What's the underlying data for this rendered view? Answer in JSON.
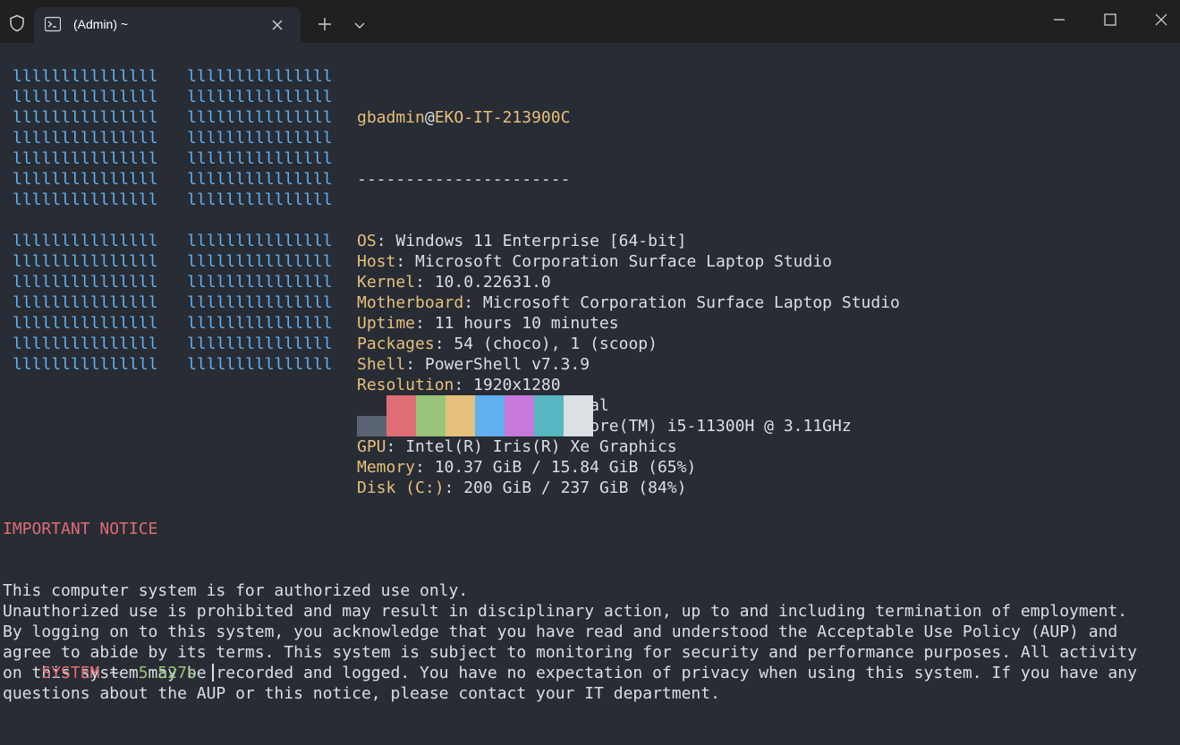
{
  "window": {
    "tab_title": "(Admin) ~",
    "icons": [
      "shield-icon",
      "powershell-icon",
      "close-icon",
      "plus-icon",
      "chevron-down-icon",
      "minimize-icon",
      "maximize-icon",
      "window-close-icon"
    ]
  },
  "logo": {
    "color": "#61afef",
    "rows": [
      "lllllllllllllll   lllllllllllllll",
      "lllllllllllllll   lllllllllllllll",
      "lllllllllllllll   lllllllllllllll",
      "lllllllllllllll   lllllllllllllll",
      "lllllllllllllll   lllllllllllllll",
      "lllllllllllllll   lllllllllllllll",
      "lllllllllllllll   lllllllllllllll",
      "",
      "lllllllllllllll   lllllllllllllll",
      "lllllllllllllll   lllllllllllllll",
      "lllllllllllllll   lllllllllllllll",
      "lllllllllllllll   lllllllllllllll",
      "lllllllllllllll   lllllllllllllll",
      "lllllllllllllll   lllllllllllllll",
      "lllllllllllllll   lllllllllllllll"
    ]
  },
  "sysinfo": {
    "user": "gbadmin",
    "at": "@",
    "host": "EKO-IT-213900C",
    "separator": "----------------------",
    "rows": [
      {
        "key": "OS",
        "value": ": Windows 11 Enterprise [64-bit]"
      },
      {
        "key": "Host",
        "value": ": Microsoft Corporation Surface Laptop Studio"
      },
      {
        "key": "Kernel",
        "value": ": 10.0.22631.0"
      },
      {
        "key": "Motherboard",
        "value": ": Microsoft Corporation Surface Laptop Studio"
      },
      {
        "key": "Uptime",
        "value": ": 11 hours 10 minutes"
      },
      {
        "key": "Packages",
        "value": ": 54 (choco), 1 (scoop)"
      },
      {
        "key": "Shell",
        "value": ": PowerShell v7.3.9"
      },
      {
        "key": "Resolution",
        "value": ": 1920x1280"
      },
      {
        "key": "Terminal",
        "value": ": Windows Terminal"
      },
      {
        "key": "CPU",
        "value": ": 11th Gen Intel(R) Core(TM) i5-11300H @ 3.11GHz"
      },
      {
        "key": "GPU",
        "value": ": Intel(R) Iris(R) Xe Graphics"
      },
      {
        "key": "Memory",
        "value": ": 10.37 GiB / 15.84 GiB (65%)"
      },
      {
        "key": "Disk (C:)",
        "value": ": 200 GiB / 237 GiB (84%)"
      }
    ]
  },
  "palette": {
    "top": [
      "#282c34",
      "#e06c75",
      "#98c379",
      "#e5c07b",
      "#61afef",
      "#c678dd",
      "#56b6c2",
      "#dcdfe4"
    ],
    "bottom": [
      "#5a6374",
      "#e06c75",
      "#98c379",
      "#e5c07b",
      "#61afef",
      "#c678dd",
      "#56b6c2",
      "#dcdfe4"
    ]
  },
  "notice": {
    "title": "IMPORTANT NOTICE",
    "lines": [
      "This computer system is for authorized use only.",
      "Unauthorized use is prohibited and may result in disciplinary action, up to and including termination of employment.",
      "By logging on to this system, you acknowledge that you have read and understood the Acceptable Use Policy (AUP) and",
      "agree to abide by its terms. This system is subject to monitoring for security and performance purposes. All activity",
      "on this system may be recorded and logged. You have no expectation of privacy when using this system. If you have any",
      "questions about the AUP or this notice, please contact your IT department."
    ]
  },
  "prompt": {
    "system": "SYSTEM",
    "path": " ~ ",
    "duration": " 5.527s "
  }
}
